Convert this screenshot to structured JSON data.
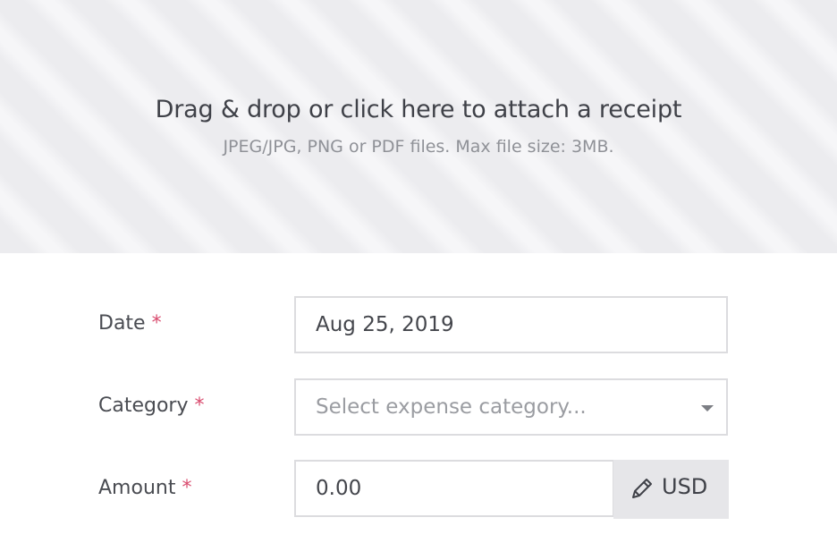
{
  "dropzone": {
    "title": "Drag & drop or click here to attach a receipt",
    "subtitle": "JPEG/JPG, PNG or PDF files. Max file size: 3MB."
  },
  "form": {
    "required_marker": "*",
    "date": {
      "label": "Date",
      "value": "Aug 25, 2019"
    },
    "category": {
      "label": "Category",
      "placeholder": "Select expense category..."
    },
    "amount": {
      "label": "Amount",
      "value": "0.00",
      "currency": "USD"
    }
  },
  "icons": {
    "edit": "pencil-icon",
    "dropdown": "chevron-down-icon"
  },
  "colors": {
    "required": "#d94b6e",
    "border": "#dcdcdf",
    "currency_bg": "#e6e6e9"
  }
}
